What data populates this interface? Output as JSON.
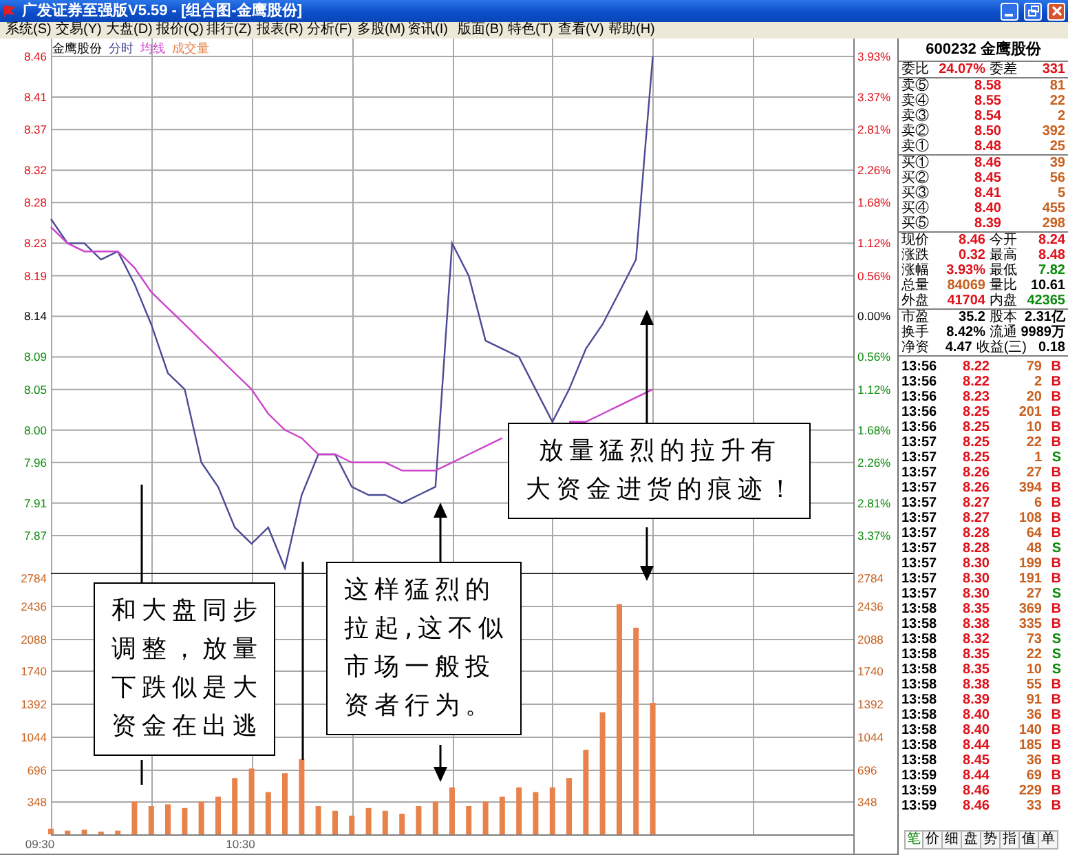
{
  "window": {
    "title": "广发证券至强版V5.59 - [组合图-金鹰股份]"
  },
  "menu": [
    "系统(S)",
    "交易(Y)",
    "大盘(D)",
    "报价(Q)",
    "排行(Z)",
    "报表(R)",
    "分析(F)",
    "多股(M)",
    "资讯(I)",
    "版面(B)",
    "特色(T)",
    "查看(V)",
    "帮助(H)"
  ],
  "price_chart": {
    "chart_data": {
      "type": "line",
      "title": "金鹰股份",
      "grid": true,
      "ylim": [
        7.82,
        8.46
      ],
      "yticks": [
        {
          "value": 8.46,
          "label": "8.46"
        },
        {
          "value": 8.41,
          "label": "8.41"
        },
        {
          "value": 8.37,
          "label": "8.37"
        },
        {
          "value": 8.32,
          "label": "8.32"
        },
        {
          "value": 8.28,
          "label": "8.28"
        },
        {
          "value": 8.23,
          "label": "8.23"
        },
        {
          "value": 8.19,
          "label": "8.19"
        },
        {
          "value": 8.14,
          "label": "8.14"
        },
        {
          "value": 8.09,
          "label": "8.09"
        },
        {
          "value": 8.05,
          "label": "8.05"
        },
        {
          "value": 8,
          "label": "8.00"
        },
        {
          "value": 7.96,
          "label": "7.96"
        },
        {
          "value": 7.91,
          "label": "7.91"
        },
        {
          "value": 7.87,
          "label": "7.87"
        }
      ],
      "series": [
        {
          "name": "分时",
          "color": "#4a4a96",
          "values": [
            8.26,
            8.23,
            8.23,
            8.21,
            8.22,
            8.18,
            8.13,
            8.07,
            8.05,
            7.96,
            7.93,
            7.88,
            7.86,
            7.88,
            7.83,
            7.92,
            7.97,
            7.97,
            7.93,
            7.92,
            7.92,
            7.91,
            7.92,
            7.93,
            8.23,
            8.19,
            8.11,
            8.1,
            8.09,
            8.05,
            8.01,
            8.05,
            8.1,
            8.13,
            8.17,
            8.21,
            8.46
          ]
        },
        {
          "name": "均线",
          "color": "#cc44cc",
          "values": [
            8.25,
            8.23,
            8.22,
            8.22,
            8.22,
            8.2,
            8.17,
            8.15,
            8.13,
            8.11,
            8.09,
            8.07,
            8.05,
            8.02,
            8,
            7.99,
            7.97,
            7.97,
            7.96,
            7.96,
            7.96,
            7.95,
            7.95,
            7.95,
            7.96,
            7.97,
            7.98,
            7.99,
            null,
            null,
            null,
            8.01,
            8.01,
            8.02,
            8.03,
            8.04,
            8.05
          ]
        }
      ]
    },
    "percent_ticks": [
      "3.93%",
      "3.37%",
      "2.81%",
      "2.26%",
      "1.68%",
      "1.12%",
      "0.56%",
      "0.00%",
      "0.56%",
      "1.12%",
      "1.68%",
      "2.26%",
      "2.81%",
      "3.37%"
    ]
  },
  "volume_chart": {
    "time_labels": [
      "09:30",
      "10:30"
    ],
    "chart_data": {
      "type": "bar",
      "grid": true,
      "ylim": [
        0,
        2784
      ],
      "yticks": [
        {
          "value": 2784,
          "label": "2784"
        },
        {
          "value": 2436,
          "label": "2436"
        },
        {
          "value": 2088,
          "label": "2088"
        },
        {
          "value": 1740,
          "label": "1740"
        },
        {
          "value": 1392,
          "label": "1392"
        },
        {
          "value": 1044,
          "label": "1044"
        },
        {
          "value": 696,
          "label": "696"
        },
        {
          "value": 348,
          "label": "348"
        }
      ],
      "series": [
        {
          "name": "成交量",
          "color": "#e8824a",
          "values": [
            60,
            40,
            50,
            30,
            40,
            350,
            300,
            320,
            280,
            350,
            400,
            600,
            700,
            450,
            650,
            800,
            300,
            250,
            200,
            280,
            250,
            220,
            300,
            350,
            500,
            300,
            350,
            400,
            500,
            450,
            500,
            600,
            900,
            1300,
            2450,
            2200,
            1400
          ]
        }
      ]
    },
    "right_ticks": [
      "2784",
      "2436",
      "2088",
      "1740",
      "1392",
      "1044",
      "696",
      "348"
    ]
  },
  "callouts": [
    {
      "lines": [
        "和大盘同步",
        "调整，放量",
        "下跌似是大",
        "资金在出逃"
      ]
    },
    {
      "lines": [
        "这样猛烈的",
        "拉起,这不似",
        "市场一般投",
        "资者行为。"
      ]
    },
    {
      "lines": [
        " 放量猛烈的拉升有",
        "大资金进货的痕迹！"
      ]
    }
  ],
  "panel": {
    "title": "600232 金鹰股份",
    "commission": {
      "cells": [
        {
          "label": "委比",
          "value": "24.07%",
          "color": "#e0101a"
        },
        {
          "label": "委差",
          "value": "331",
          "color": "#e0101a"
        }
      ]
    },
    "asks": [
      {
        "label": "卖⑤",
        "price": "8.58",
        "volume": "81"
      },
      {
        "label": "卖④",
        "price": "8.55",
        "volume": "22"
      },
      {
        "label": "卖③",
        "price": "8.54",
        "volume": "2"
      },
      {
        "label": "卖②",
        "price": "8.50",
        "volume": "392"
      },
      {
        "label": "卖①",
        "price": "8.48",
        "volume": "25"
      }
    ],
    "bids": [
      {
        "label": "买①",
        "price": "8.46",
        "volume": "39"
      },
      {
        "label": "买②",
        "price": "8.45",
        "volume": "56"
      },
      {
        "label": "买③",
        "price": "8.41",
        "volume": "5"
      },
      {
        "label": "买④",
        "price": "8.40",
        "volume": "455"
      },
      {
        "label": "买⑤",
        "price": "8.39",
        "volume": "298"
      }
    ],
    "stats": [
      {
        "cells": [
          {
            "label": "现价",
            "value": "8.46",
            "color": "#e0101a"
          },
          {
            "label": "今开",
            "value": "8.24",
            "color": "#e0101a"
          }
        ]
      },
      {
        "cells": [
          {
            "label": "涨跌",
            "value": "0.32",
            "color": "#e0101a"
          },
          {
            "label": "最高",
            "value": "8.48",
            "color": "#e0101a"
          }
        ]
      },
      {
        "cells": [
          {
            "label": "涨幅",
            "value": "3.93%",
            "color": "#e0101a"
          },
          {
            "label": "最低",
            "value": "7.82",
            "color": "#0a8a0a"
          }
        ]
      },
      {
        "cells": [
          {
            "label": "总量",
            "value": "84069",
            "color": "#c8601e"
          },
          {
            "label": "量比",
            "value": "10.61",
            "color": "#000000"
          }
        ]
      },
      {
        "cells": [
          {
            "label": "外盘",
            "value": "41704",
            "color": "#e0101a"
          },
          {
            "label": "内盘",
            "value": "42365",
            "color": "#0a8a0a"
          }
        ]
      }
    ],
    "fundamentals": [
      {
        "cells": [
          {
            "label": "市盈",
            "value": "35.2"
          },
          {
            "label": "股本",
            "value": "2.31亿"
          }
        ]
      },
      {
        "cells": [
          {
            "label": "换手",
            "value": "8.42%"
          },
          {
            "label": "流通",
            "value": "9989万"
          }
        ]
      },
      {
        "cells": [
          {
            "label": "净资",
            "value": "4.47"
          },
          {
            "label": "收益(三)",
            "value": "0.18"
          }
        ]
      }
    ],
    "trades": [
      {
        "time": "13:56",
        "price": "8.22",
        "volume": "79",
        "side": "B",
        "kind": "buy"
      },
      {
        "time": "13:56",
        "price": "8.22",
        "volume": "2",
        "side": "B",
        "kind": "buy"
      },
      {
        "time": "13:56",
        "price": "8.23",
        "volume": "20",
        "side": "B",
        "kind": "buy"
      },
      {
        "time": "13:56",
        "price": "8.25",
        "volume": "201",
        "side": "B",
        "kind": "buy"
      },
      {
        "time": "13:56",
        "price": "8.25",
        "volume": "10",
        "side": "B",
        "kind": "buy"
      },
      {
        "time": "13:57",
        "price": "8.25",
        "volume": "22",
        "side": "B",
        "kind": "buy"
      },
      {
        "time": "13:57",
        "price": "8.25",
        "volume": "1",
        "side": "S",
        "kind": "sell"
      },
      {
        "time": "13:57",
        "price": "8.26",
        "volume": "27",
        "side": "B",
        "kind": "buy"
      },
      {
        "time": "13:57",
        "price": "8.26",
        "volume": "394",
        "side": "B",
        "kind": "buy"
      },
      {
        "time": "13:57",
        "price": "8.27",
        "volume": "6",
        "side": "B",
        "kind": "buy"
      },
      {
        "time": "13:57",
        "price": "8.27",
        "volume": "108",
        "side": "B",
        "kind": "buy"
      },
      {
        "time": "13:57",
        "price": "8.28",
        "volume": "64",
        "side": "B",
        "kind": "buy"
      },
      {
        "time": "13:57",
        "price": "8.28",
        "volume": "48",
        "side": "S",
        "kind": "sell"
      },
      {
        "time": "13:57",
        "price": "8.30",
        "volume": "199",
        "side": "B",
        "kind": "buy"
      },
      {
        "time": "13:57",
        "price": "8.30",
        "volume": "191",
        "side": "B",
        "kind": "buy"
      },
      {
        "time": "13:57",
        "price": "8.30",
        "volume": "27",
        "side": "S",
        "kind": "sell"
      },
      {
        "time": "13:58",
        "price": "8.35",
        "volume": "369",
        "side": "B",
        "kind": "buy"
      },
      {
        "time": "13:58",
        "price": "8.38",
        "volume": "335",
        "side": "B",
        "kind": "buy"
      },
      {
        "time": "13:58",
        "price": "8.32",
        "volume": "73",
        "side": "S",
        "kind": "sell"
      },
      {
        "time": "13:58",
        "price": "8.35",
        "volume": "22",
        "side": "S",
        "kind": "sell"
      },
      {
        "time": "13:58",
        "price": "8.35",
        "volume": "10",
        "side": "S",
        "kind": "sell"
      },
      {
        "time": "13:58",
        "price": "8.38",
        "volume": "55",
        "side": "B",
        "kind": "buy"
      },
      {
        "time": "13:58",
        "price": "8.39",
        "volume": "91",
        "side": "B",
        "kind": "buy"
      },
      {
        "time": "13:58",
        "price": "8.40",
        "volume": "36",
        "side": "B",
        "kind": "buy"
      },
      {
        "time": "13:58",
        "price": "8.40",
        "volume": "140",
        "side": "B",
        "kind": "buy"
      },
      {
        "time": "13:58",
        "price": "8.44",
        "volume": "185",
        "side": "B",
        "kind": "buy"
      },
      {
        "time": "13:58",
        "price": "8.45",
        "volume": "36",
        "side": "B",
        "kind": "buy"
      },
      {
        "time": "13:59",
        "price": "8.44",
        "volume": "69",
        "side": "B",
        "kind": "buy"
      },
      {
        "time": "13:59",
        "price": "8.46",
        "volume": "229",
        "side": "B",
        "kind": "buy"
      },
      {
        "time": "13:59",
        "price": "8.46",
        "volume": "33",
        "side": "B",
        "kind": "buy"
      }
    ],
    "tabs": [
      {
        "label": "笔",
        "selected": true
      },
      {
        "label": "价",
        "selected": false
      },
      {
        "label": "细",
        "selected": false
      },
      {
        "label": "盘",
        "selected": false
      },
      {
        "label": "势",
        "selected": false
      },
      {
        "label": "指",
        "selected": false
      },
      {
        "label": "值",
        "selected": false
      },
      {
        "label": "单",
        "selected": false
      }
    ]
  }
}
